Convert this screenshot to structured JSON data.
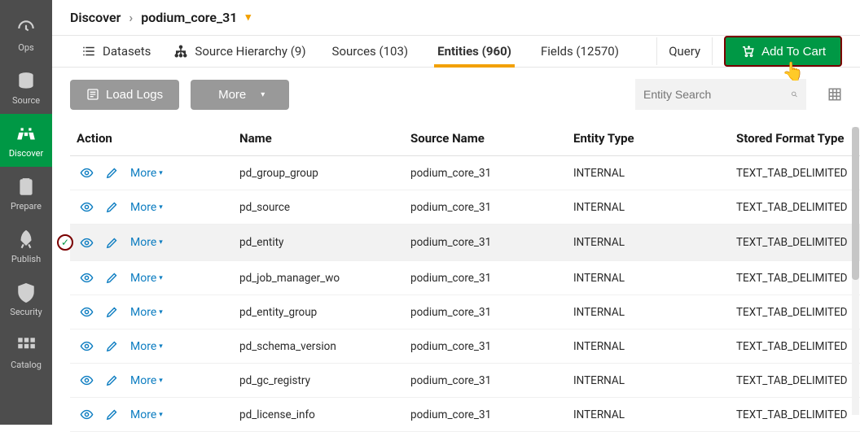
{
  "sidebar": {
    "items": [
      {
        "key": "ops",
        "label": "Ops"
      },
      {
        "key": "source",
        "label": "Source"
      },
      {
        "key": "discover",
        "label": "Discover"
      },
      {
        "key": "prepare",
        "label": "Prepare"
      },
      {
        "key": "publish",
        "label": "Publish"
      },
      {
        "key": "security",
        "label": "Security"
      },
      {
        "key": "catalog",
        "label": "Catalog"
      }
    ],
    "activeKey": "discover"
  },
  "breadcrumb": {
    "root": "Discover",
    "current": "podium_core_31"
  },
  "toolbar": {
    "datasets_label": "Datasets",
    "hierarchy_label": "Source Hierarchy (9)",
    "tabs": [
      {
        "key": "sources",
        "label": "Sources (103)"
      },
      {
        "key": "entities",
        "label": "Entities (960)"
      },
      {
        "key": "fields",
        "label": "Fields (12570)"
      }
    ],
    "activeTab": "entities",
    "query_label": "Query",
    "add_cart_label": "Add To Cart"
  },
  "actions": {
    "load_logs_label": "Load Logs",
    "more_label": "More",
    "search_placeholder": "Entity Search"
  },
  "table": {
    "columns": {
      "action": "Action",
      "name": "Name",
      "source_name": "Source Name",
      "entity_type": "Entity Type",
      "stored_format": "Stored Format Type"
    },
    "more_label": "More",
    "rows": [
      {
        "selected": false,
        "name": "pd_group_group",
        "source_name": "podium_core_31",
        "entity_type": "INTERNAL",
        "stored_format": "TEXT_TAB_DELIMITED"
      },
      {
        "selected": false,
        "name": "pd_source",
        "source_name": "podium_core_31",
        "entity_type": "INTERNAL",
        "stored_format": "TEXT_TAB_DELIMITED"
      },
      {
        "selected": true,
        "name": "pd_entity",
        "source_name": "podium_core_31",
        "entity_type": "INTERNAL",
        "stored_format": "TEXT_TAB_DELIMITED"
      },
      {
        "selected": false,
        "name": "pd_job_manager_wo",
        "source_name": "podium_core_31",
        "entity_type": "INTERNAL",
        "stored_format": "TEXT_TAB_DELIMITED"
      },
      {
        "selected": false,
        "name": "pd_entity_group",
        "source_name": "podium_core_31",
        "entity_type": "INTERNAL",
        "stored_format": "TEXT_TAB_DELIMITED"
      },
      {
        "selected": false,
        "name": "pd_schema_version",
        "source_name": "podium_core_31",
        "entity_type": "INTERNAL",
        "stored_format": "TEXT_TAB_DELIMITED"
      },
      {
        "selected": false,
        "name": "pd_gc_registry",
        "source_name": "podium_core_31",
        "entity_type": "INTERNAL",
        "stored_format": "TEXT_TAB_DELIMITED"
      },
      {
        "selected": false,
        "name": "pd_license_info",
        "source_name": "podium_core_31",
        "entity_type": "INTERNAL",
        "stored_format": "TEXT_TAB_DELIMITED"
      }
    ]
  }
}
